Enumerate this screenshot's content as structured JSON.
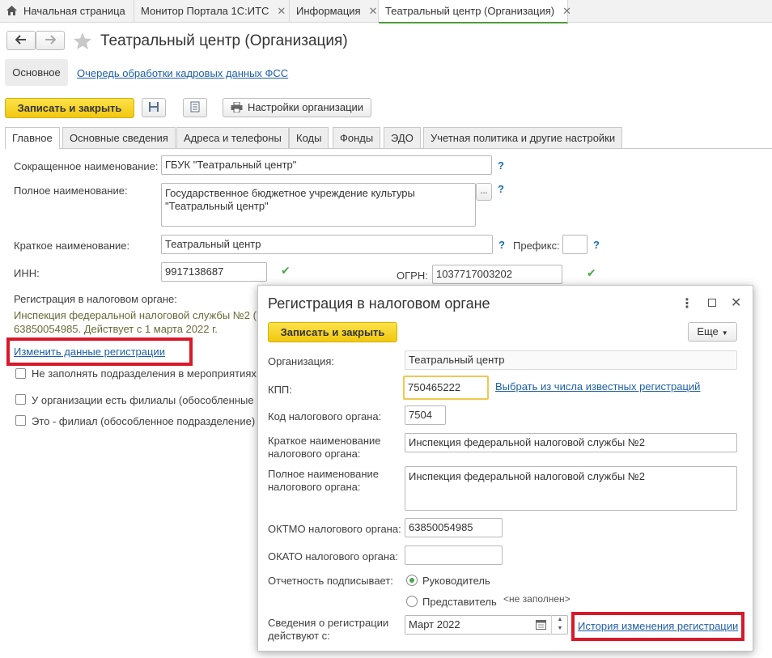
{
  "top_tabs": [
    {
      "label": "Начальная страница"
    },
    {
      "label": "Монитор Портала 1С:ИТС"
    },
    {
      "label": "Информация"
    },
    {
      "label": "Театральный центр (Организация)"
    }
  ],
  "page": {
    "title": "Театральный центр (Организация)",
    "nav_main": "Основное",
    "nav_link": "Очередь обработки кадровых данных ФСС",
    "save_close": "Записать и закрыть",
    "settings_btn": "Настройки организации"
  },
  "form_tabs": [
    "Главное",
    "Основные сведения",
    "Адреса и телефоны",
    "Коды",
    "Фонды",
    "ЭДО",
    "Учетная политика и другие настройки"
  ],
  "main": {
    "short_name_label": "Сокращенное наименование:",
    "short_name_value": "ГБУК \"Театральный центр\"",
    "full_name_label": "Полное наименование:",
    "full_name_line1": "Государственное бюджетное учреждение культуры",
    "full_name_line2": "\"Театральный центр\"",
    "brief_name_label": "Краткое наименование:",
    "brief_name_value": "Театральный центр",
    "prefix_label": "Префикс:",
    "inn_label": "ИНН:",
    "inn_value": "9917138687",
    "ogrn_label": "ОГРН:",
    "ogrn_value": "1037717003202",
    "tax_reg_label": "Регистрация в налоговом органе:",
    "tax_reg_line1": "Инспекция федеральной налоговой службы №2 (7",
    "tax_reg_line2": "63850054985. Действует с 1 марта 2022 г.",
    "change_reg_link": "Изменить данные регистрации",
    "cb1": "Не заполнять подразделения в мероприятиях",
    "cb2": "У организации есть филиалы (обособленные по",
    "cb3": "Это - филиал (обособленное подразделение)",
    "q": "?",
    "more": "..."
  },
  "modal": {
    "title": "Регистрация в налоговом органе",
    "save_close": "Записать и закрыть",
    "more_btn": "Еще",
    "org_label": "Организация:",
    "org_value": "Театральный центр",
    "kpp_label": "КПП:",
    "kpp_value": "750465222",
    "kpp_link": "Выбрать из числа известных регистраций",
    "code_label": "Код налогового органа:",
    "code_value": "7504",
    "short_label_1": "Краткое наименование",
    "short_label_2": "налогового органа:",
    "short_value": "Инспекция федеральной налоговой службы №2",
    "full_label_1": "Полное наименование",
    "full_label_2": "налогового органа:",
    "full_value": "Инспекция федеральной налоговой службы №2",
    "oktmo_label": "ОКТМО налогового органа:",
    "oktmo_value": "63850054985",
    "okato_label": "ОКАТО налогового органа:",
    "okato_value": "",
    "signs_label": "Отчетность подписывает:",
    "radio_head": "Руководитель",
    "radio_rep": "Представитель",
    "not_filled": "<не заполнен>",
    "valid_label_1": "Сведения о регистрации",
    "valid_label_2": "действуют с:",
    "valid_value": "Март 2022",
    "history_link": "История изменения регистрации"
  },
  "colors": {
    "accent_green": "#4f9a3a",
    "yellow_btn": "#f5cf1f",
    "link": "#1d5fa8",
    "highlight": "#d9192a"
  }
}
